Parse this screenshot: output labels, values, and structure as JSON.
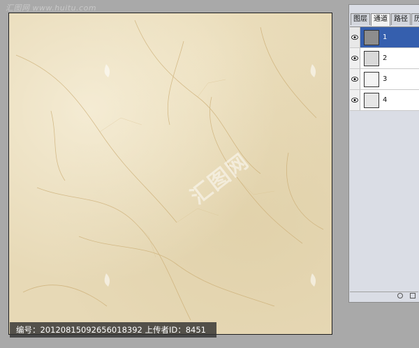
{
  "site_watermark": "汇图网 www.huitu.com",
  "center_watermark": "汇图网",
  "caption": "编号：20120815092656018392 上传者ID：8451",
  "panel": {
    "tabs": [
      "图层",
      "通道",
      "路径",
      "历"
    ],
    "active_tab": 1,
    "channels": [
      {
        "label": "1",
        "selected": true
      },
      {
        "label": "2",
        "selected": false
      },
      {
        "label": "3",
        "selected": false
      },
      {
        "label": "4",
        "selected": false
      }
    ]
  },
  "colors": {
    "marble_base": "#e7d9b6",
    "vein": "#c9a96e",
    "selection": "#355fae"
  }
}
